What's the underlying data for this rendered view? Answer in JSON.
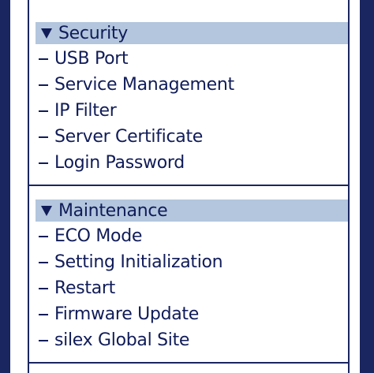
{
  "colors": {
    "frame_navy": "#1a2660",
    "header_bg": "#b3c6de",
    "text": "#101c58"
  },
  "icons": {
    "collapse": "triangle-down-icon",
    "item_bullet": "dash-icon"
  },
  "sections": [
    {
      "title": "Security",
      "items": [
        {
          "label": "USB Port"
        },
        {
          "label": "Service Management"
        },
        {
          "label": "IP Filter"
        },
        {
          "label": "Server Certificate"
        },
        {
          "label": "Login Password"
        }
      ]
    },
    {
      "title": "Maintenance",
      "items": [
        {
          "label": "ECO Mode"
        },
        {
          "label": "Setting Initialization"
        },
        {
          "label": "Restart"
        },
        {
          "label": "Firmware Update"
        },
        {
          "label": "silex Global Site"
        }
      ]
    }
  ]
}
